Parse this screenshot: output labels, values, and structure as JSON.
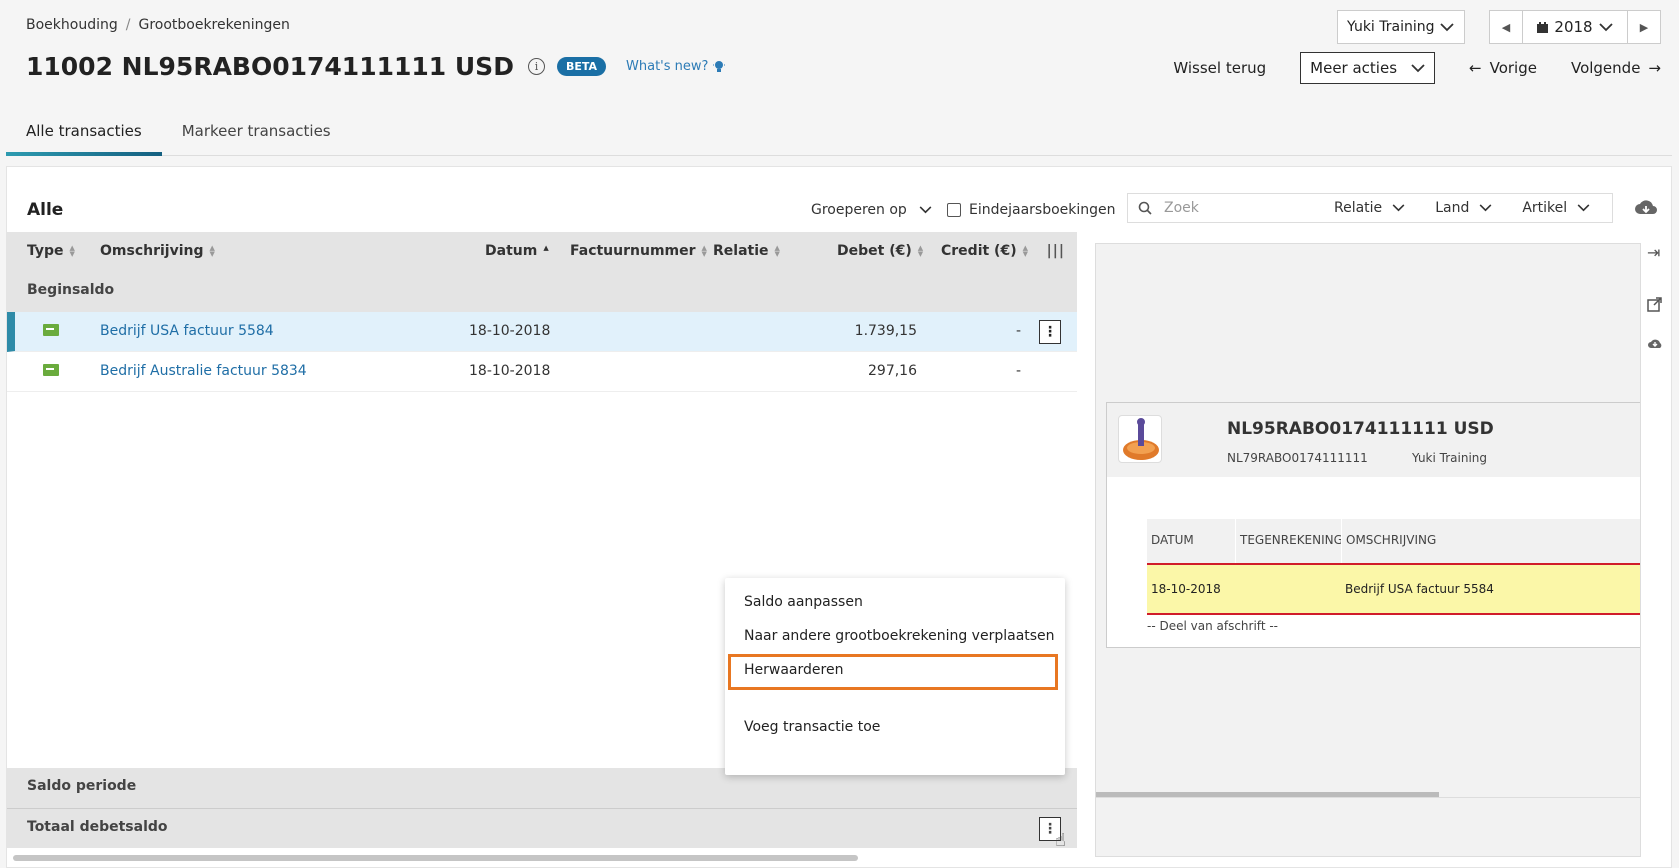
{
  "breadcrumb": {
    "root": "Boekhouding",
    "sep": "/",
    "current": "Grootboekrekeningen"
  },
  "company_select": {
    "value": "Yuki Training"
  },
  "year": {
    "value": "2018"
  },
  "page": {
    "title": "11002 NL95RABO0174111111 USD",
    "beta": "BETA",
    "whats_new": "What's new?"
  },
  "actions": {
    "wissel_terug": "Wissel terug",
    "meer_acties": "Meer acties",
    "vorige": "Vorige",
    "volgende": "Volgende"
  },
  "tabs": [
    {
      "label": "Alle transacties",
      "active": true
    },
    {
      "label": "Markeer transacties",
      "active": false
    }
  ],
  "toolbar": {
    "title": "Alle",
    "group_by": "Groeperen op",
    "year_end": "Eindejaarsboekingen",
    "search_placeholder": "Zoek",
    "filters": [
      "Relatie",
      "Land",
      "Artikel"
    ]
  },
  "columns": {
    "type": "Type",
    "omschrijving": "Omschrijving",
    "datum": "Datum",
    "factuurnummer": "Factuurnummer",
    "relatie": "Relatie",
    "debet": "Debet (€)",
    "credit": "Credit (€)"
  },
  "begin_saldo": "Beginsaldo",
  "rows": [
    {
      "description": "Bedrijf USA factuur 5584",
      "date": "18-10-2018",
      "debet": "1.739,15",
      "credit": "-",
      "selected": true
    },
    {
      "description": "Bedrijf Australie factuur 5834",
      "date": "18-10-2018",
      "debet": "297,16",
      "credit": "-",
      "selected": false
    }
  ],
  "footer": {
    "saldo_periode": "Saldo periode",
    "totaal": "Totaal debetsaldo"
  },
  "context_menu": {
    "items": [
      "Saldo aanpassen",
      "Naar andere grootboekrekening verplaatsen",
      "Herwaarderen",
      "Voeg transactie toe"
    ],
    "highlighted": "Herwaarderen"
  },
  "preview": {
    "title": "NL95RABO0174111111 USD",
    "iban": "NL79RABO0174111111",
    "owner": "Yuki Training",
    "headers": [
      "DATUM",
      "TEGENREKENING",
      "OMSCHRIJVING"
    ],
    "row": {
      "date": "18-10-2018",
      "description": "Bedrijf USA factuur 5584"
    },
    "note": "-- Deel van afschrift --"
  },
  "colors": {
    "accent": "#1f6ea6",
    "tab_underline": "#2d9bb0",
    "highlight_border": "#e87722",
    "statement_row": "#fbf7a8",
    "statement_border": "#d01c2a"
  }
}
